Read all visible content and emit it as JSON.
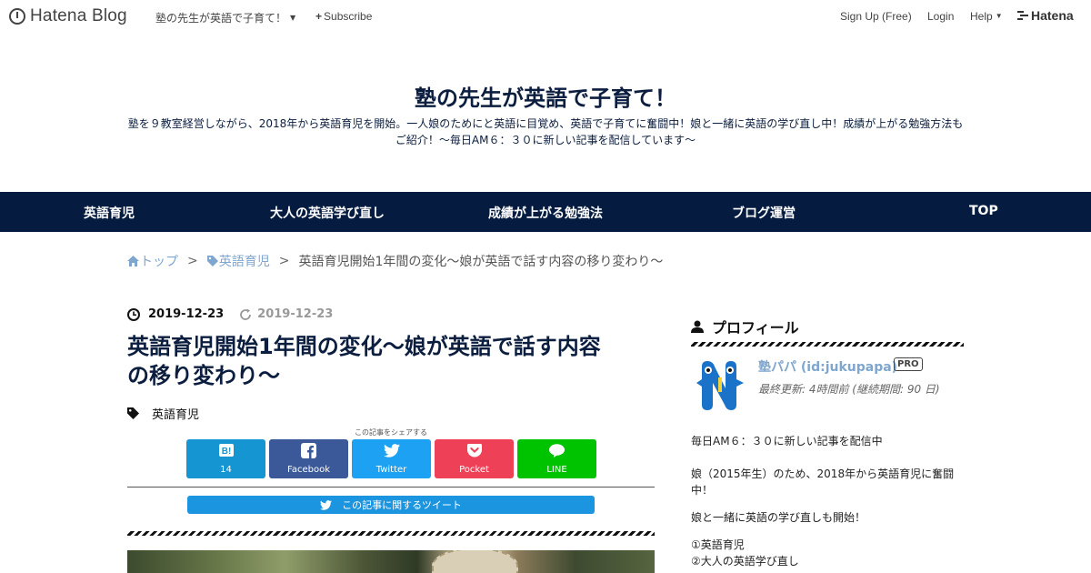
{
  "topbar": {
    "brand": "Hatena Blog",
    "blog_dropdown": "塾の先生が英語で子育て！",
    "subscribe": "Subscribe",
    "signup": "Sign Up (Free)",
    "login": "Login",
    "help": "Help",
    "hatena": "Hatena"
  },
  "header": {
    "title": "塾の先生が英語で子育て！",
    "description_line1": "塾を９教室経営しながら、2018年から英語育児を開始。一人娘のためにと英語に目覚め、英語で子育てに奮闘中！娘と一緒に英語の学び直し中！成績が上がる勉強方法も",
    "description_line2": "ご紹介！～毎日AM６：３０に新しい記事を配信しています～"
  },
  "nav": {
    "items": [
      "英語育児",
      "大人の英語学び直し",
      "成績が上がる勉強法",
      "ブログ運営",
      "TOP"
    ]
  },
  "breadcrumb": {
    "home": "トップ",
    "category": "英語育児",
    "current": "英語育児開始1年間の変化～娘が英語で話す内容の移り変わり～",
    "separator": ">"
  },
  "article": {
    "date": "2019-12-23",
    "updated": "2019-12-23",
    "title_line1": "英語育児開始1年間の変化～娘が英語で話す内容",
    "title_line2": "の移り変わり～",
    "category": "英語育児",
    "share_caption": "この記事をシェアする",
    "share": [
      {
        "name": "hatena-bookmark",
        "label": "14",
        "color": "#1596d2"
      },
      {
        "name": "facebook",
        "label": "Facebook",
        "color": "#3b5998"
      },
      {
        "name": "twitter",
        "label": "Twitter",
        "color": "#1da1f2"
      },
      {
        "name": "pocket",
        "label": "Pocket",
        "color": "#ee4056"
      },
      {
        "name": "line",
        "label": "LINE",
        "color": "#00c300"
      }
    ],
    "tweet_button": "この記事に関するツイート"
  },
  "sidebar": {
    "profile_heading": "プロフィール",
    "name": "塾パパ (id:jukupapa)",
    "pro_badge": "PRO",
    "last_update": "最終更新: 4時間前 (継続期間: 90 日)",
    "bio1": "毎日AM６：３０に新しい記事を配信中",
    "bio2_line1": "娘（2015年生）のため、2018年から英語育児に奮闘",
    "bio2_line2": "中！",
    "bio3": "娘と一緒に英語の学び直しも開始！",
    "list1": "①英語育児",
    "list2": "②大人の英語学び直し"
  }
}
